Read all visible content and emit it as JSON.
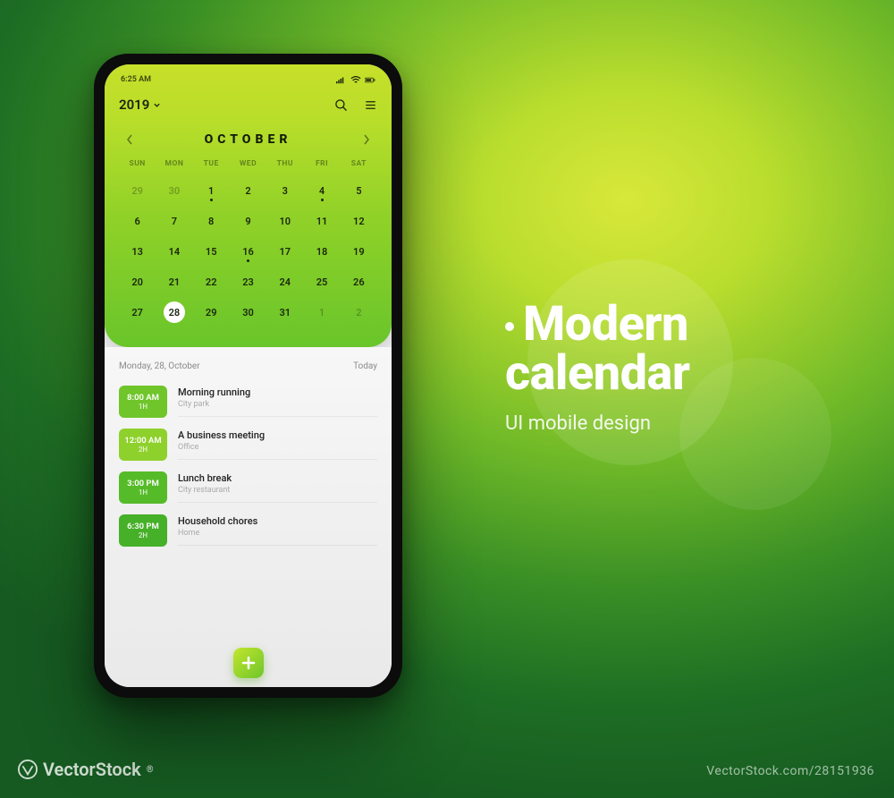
{
  "promo": {
    "title_line1": "Modern",
    "title_line2": "calendar",
    "subtitle": "UI mobile design"
  },
  "watermark": {
    "site": "VectorStock",
    "suffix": "®",
    "id": "28151936"
  },
  "status": {
    "time": "6:25 AM"
  },
  "appbar": {
    "year": "2019"
  },
  "month": {
    "name": "OCTOBER"
  },
  "dow": [
    "SUN",
    "MON",
    "TUE",
    "WED",
    "THU",
    "FRI",
    "SAT"
  ],
  "weeks": [
    [
      {
        "n": "29",
        "faded": true
      },
      {
        "n": "30",
        "faded": true
      },
      {
        "n": "1",
        "dot": true
      },
      {
        "n": "2"
      },
      {
        "n": "3"
      },
      {
        "n": "4",
        "dot": true
      },
      {
        "n": "5"
      }
    ],
    [
      {
        "n": "6"
      },
      {
        "n": "7"
      },
      {
        "n": "8"
      },
      {
        "n": "9"
      },
      {
        "n": "10"
      },
      {
        "n": "11"
      },
      {
        "n": "12"
      }
    ],
    [
      {
        "n": "13"
      },
      {
        "n": "14"
      },
      {
        "n": "15"
      },
      {
        "n": "16",
        "dot": true
      },
      {
        "n": "17"
      },
      {
        "n": "18"
      },
      {
        "n": "19"
      }
    ],
    [
      {
        "n": "20"
      },
      {
        "n": "21"
      },
      {
        "n": "22"
      },
      {
        "n": "23"
      },
      {
        "n": "24"
      },
      {
        "n": "25"
      },
      {
        "n": "26"
      }
    ],
    [
      {
        "n": "27"
      },
      {
        "n": "28",
        "selected": true
      },
      {
        "n": "29"
      },
      {
        "n": "30"
      },
      {
        "n": "31"
      },
      {
        "n": "1",
        "faded": true
      },
      {
        "n": "2",
        "faded": true
      }
    ]
  ],
  "events_header": {
    "date": "Monday, 28, October",
    "today": "Today"
  },
  "events": [
    {
      "time": "8:00 AM",
      "dur": "1H",
      "title": "Morning running",
      "loc": "City park",
      "c": "c1"
    },
    {
      "time": "12:00 AM",
      "dur": "2H",
      "title": "A business meeting",
      "loc": "Office",
      "c": "c2"
    },
    {
      "time": "3:00 PM",
      "dur": "1H",
      "title": "Lunch break",
      "loc": "City restaurant",
      "c": "c3"
    },
    {
      "time": "6:30 PM",
      "dur": "2H",
      "title": "Household chores",
      "loc": "Home",
      "c": "c4"
    }
  ]
}
